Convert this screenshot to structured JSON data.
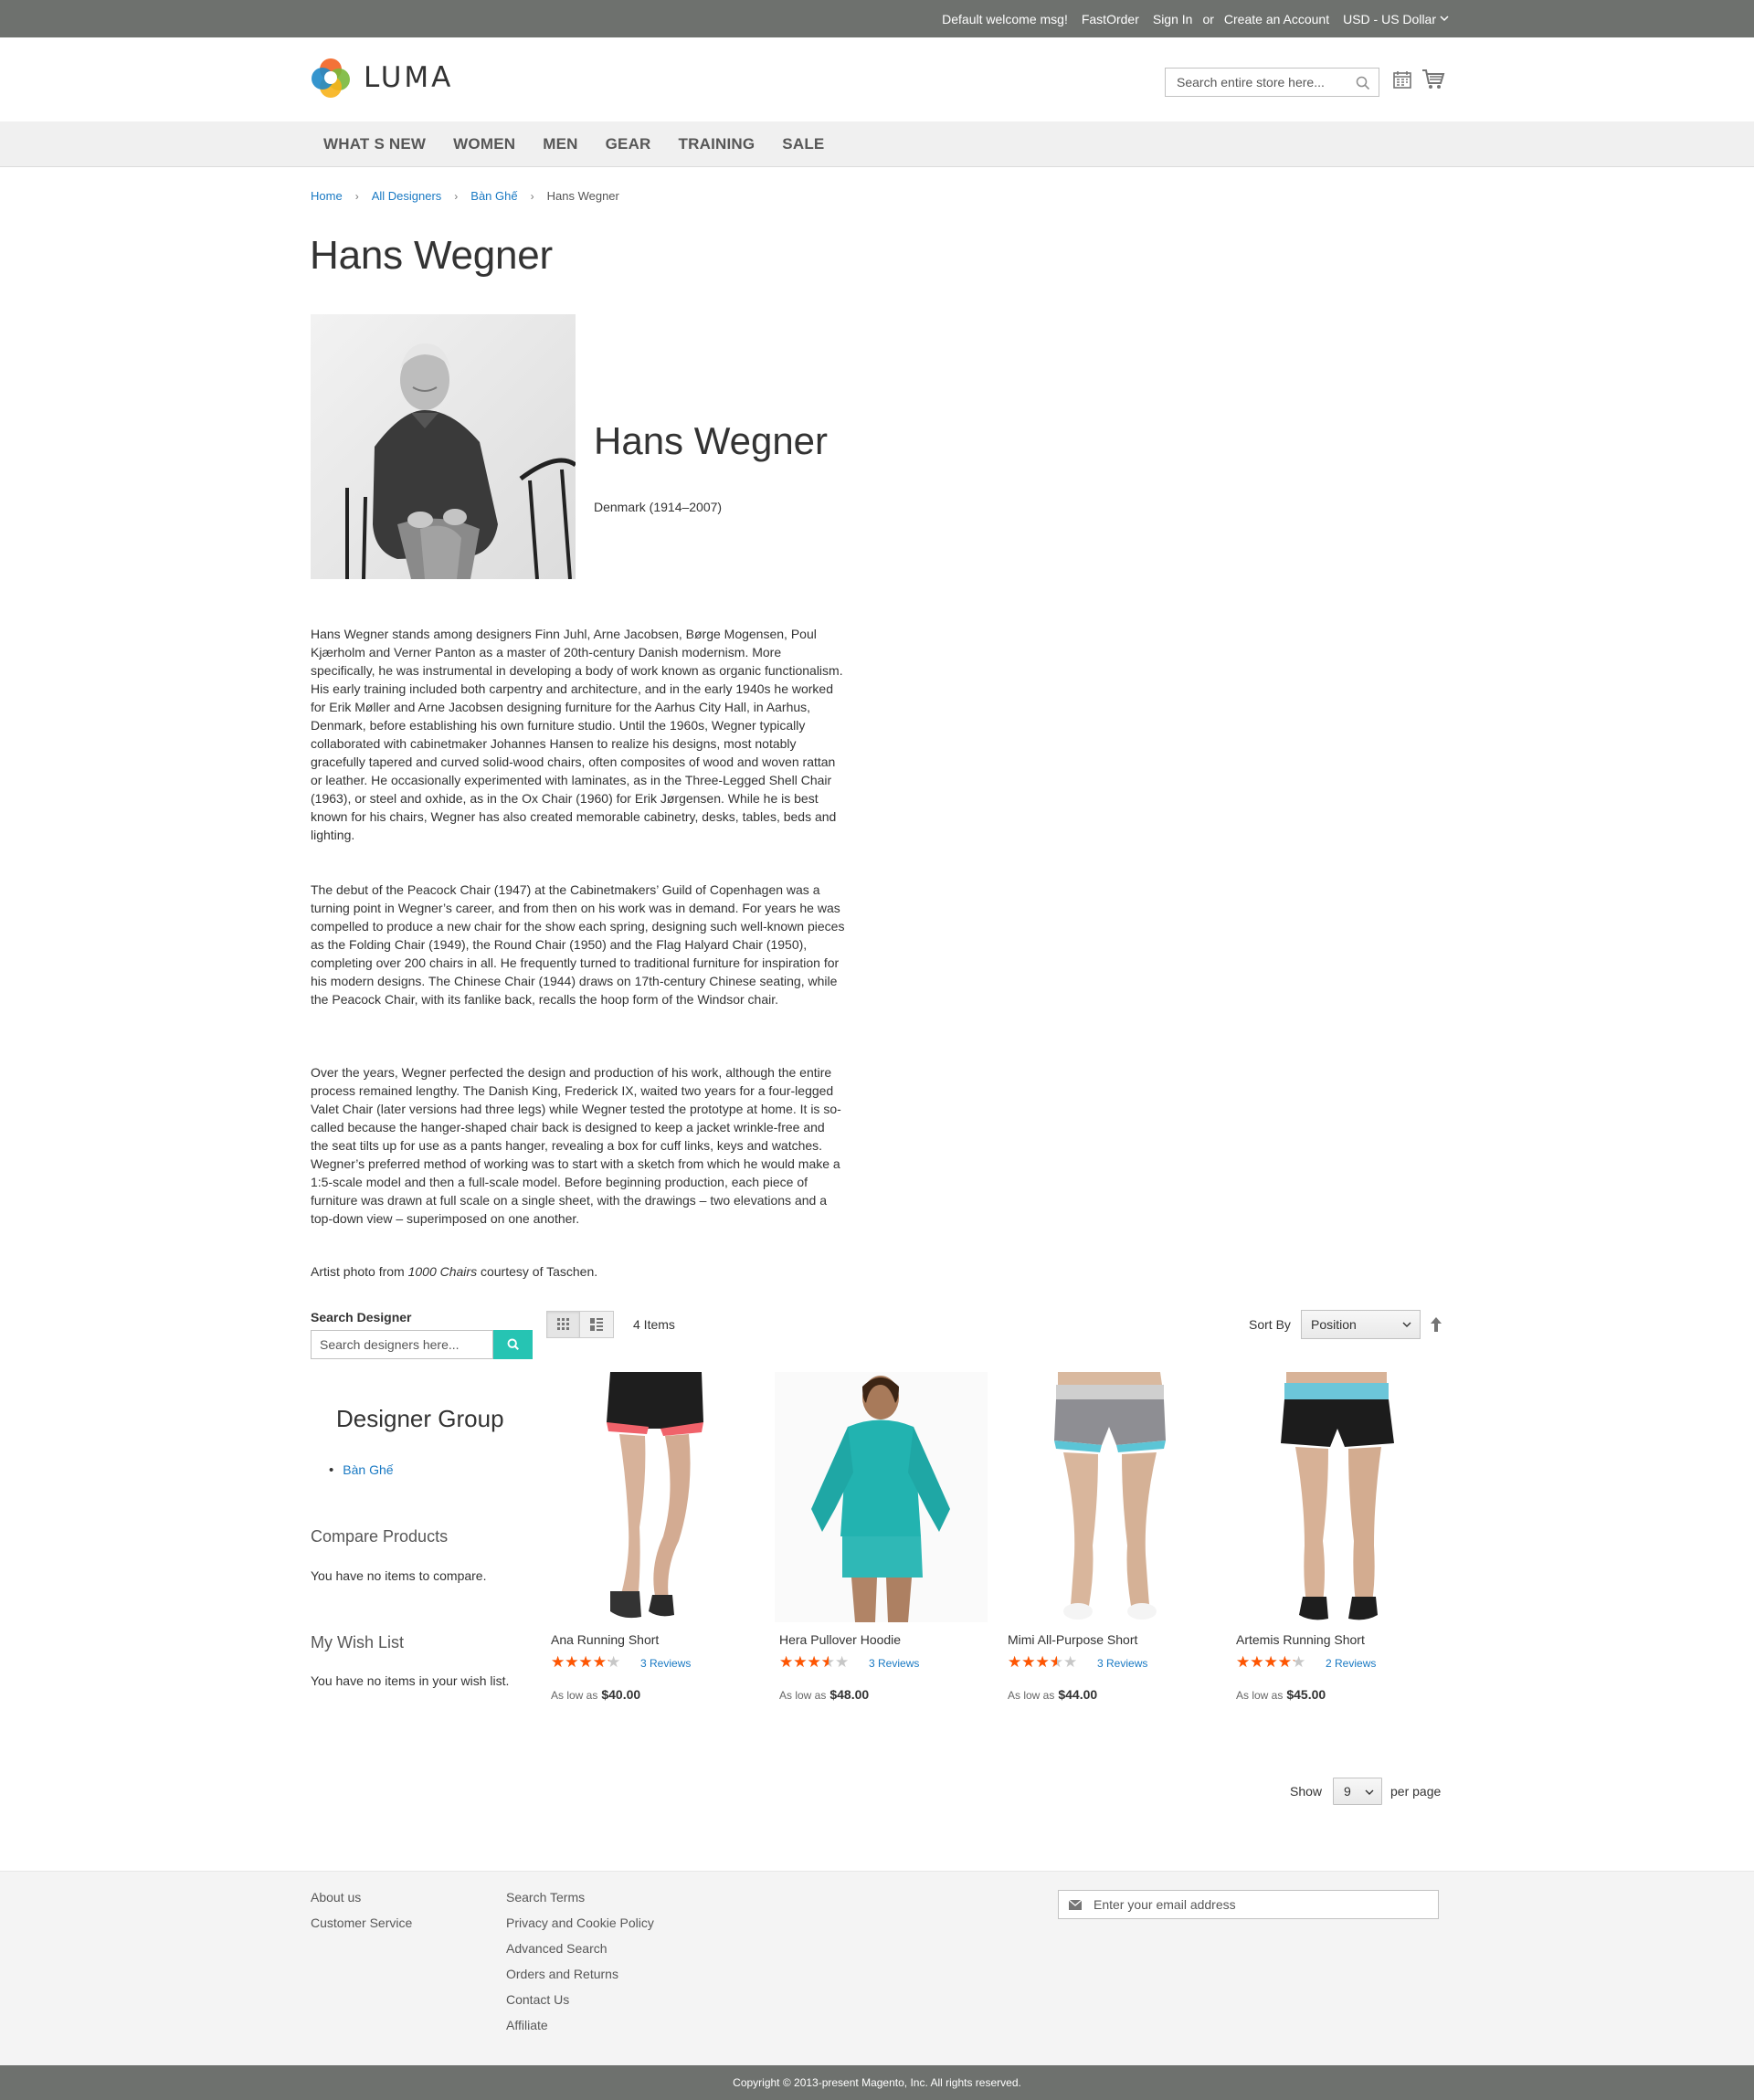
{
  "top_links": {
    "welcome": "Default welcome msg!",
    "fast_order": "FastOrder",
    "sign_in": "Sign In",
    "or": "or",
    "create_account": "Create an Account",
    "currency": "USD - US Dollar"
  },
  "header": {
    "logo_text": "LUMA",
    "search_placeholder": "Search entire store here..."
  },
  "nav": {
    "items": [
      "WHAT S NEW",
      "WOMEN",
      "MEN",
      "GEAR",
      "TRAINING",
      "SALE"
    ]
  },
  "breadcrumb": {
    "items": [
      "Home",
      "All Designers",
      "Bàn Ghế"
    ],
    "current": "Hans Wegner"
  },
  "page_title": "Hans Wegner",
  "designer": {
    "name": "Hans Wegner",
    "country": "Denmark (1914–2007)",
    "bio": [
      "Hans Wegner stands among designers Finn Juhl, Arne Jacobsen, Børge Mogensen, Poul Kjærholm and Verner Panton as a master of 20th-century Danish modernism. More specifically, he was instrumental in developing a body of work known as organic functionalism. His early training included both carpentry and architecture, and in the early 1940s he worked for Erik Møller and Arne Jacobsen designing furniture for the Aarhus City Hall, in Aarhus, Denmark, before establishing his own furniture studio. Until the 1960s, Wegner typically collaborated with cabinetmaker Johannes Hansen to realize his designs, most notably gracefully tapered and curved solid-wood chairs, often composites of wood and woven rattan or leather. He occasionally experimented with laminates, as in the Three-Legged Shell Chair (1963), or steel and oxhide, as in the Ox Chair (1960) for Erik Jørgensen. While he is best known for his chairs, Wegner has also created memorable cabinetry, desks, tables, beds and lighting.",
      "The debut of the Peacock Chair (1947) at the Cabinetmakers’ Guild of Copenhagen was a turning point in Wegner’s career, and from then on his work was in demand. For years he was compelled to produce a new chair for the show each spring, designing such well-known pieces as the Folding Chair (1949), the Round Chair (1950) and the Flag Halyard Chair (1950), completing over 200 chairs in all. He frequently turned to traditional furniture for inspiration for his modern designs. The Chinese Chair (1944) draws on 17th-century Chinese seating, while the Peacock Chair, with its fanlike back, recalls the hoop form of the Windsor chair.",
      "Over the years, Wegner perfected the design and production of his work, although the entire process remained lengthy. The Danish King, Frederick IX, waited two years for a four-legged Valet Chair (later versions had three legs) while Wegner tested the prototype at home. It is so-called because the hanger-shaped chair back is designed to keep a jacket wrinkle-free and the seat tilts up for use as a pants hanger, revealing a box for cuff links, keys and watches. Wegner’s preferred method of working was to start with a sketch from which he would make a 1:5-scale model and then a full-scale model. Before beginning production, each piece of furniture was drawn at full scale on a single sheet, with the drawings – two elevations and a top-down view – superimposed on one another."
    ],
    "credit_prefix": "Artist photo from ",
    "credit_book": "1000 Chairs",
    "credit_suffix": " courtesy of Taschen."
  },
  "sidebar": {
    "search_label": "Search Designer",
    "search_placeholder": "Search designers here...",
    "group_title": "Designer Group",
    "group_items": [
      "Bàn Ghế"
    ],
    "compare_title": "Compare Products",
    "compare_empty": "You have no items to compare.",
    "wishlist_title": "My Wish List",
    "wishlist_empty": "You have no items in your wish list."
  },
  "toolbar": {
    "item_count": "4 Items",
    "sort_label": "Sort By",
    "sort_value": "Position",
    "show_label": "Show",
    "limit_value": "9",
    "per_page": "per page"
  },
  "products": [
    {
      "name": "Ana Running Short",
      "rating_pct": 80,
      "reviews": "3 Reviews",
      "price_prefix": "As low as",
      "price": "$40.00"
    },
    {
      "name": "Hera Pullover Hoodie",
      "rating_pct": 67,
      "reviews": "3 Reviews",
      "price_prefix": "As low as",
      "price": "$48.00"
    },
    {
      "name": "Mimi All-Purpose Short",
      "rating_pct": 67,
      "reviews": "3 Reviews",
      "price_prefix": "As low as",
      "price": "$44.00"
    },
    {
      "name": "Artemis Running Short",
      "rating_pct": 80,
      "reviews": "2 Reviews",
      "price_prefix": "As low as",
      "price": "$45.00"
    }
  ],
  "footer": {
    "col1": [
      "About us",
      "Customer Service"
    ],
    "col2": [
      "Search Terms",
      "Privacy and Cookie Policy",
      "Advanced Search",
      "Orders and Returns",
      "Contact Us",
      "Affiliate"
    ],
    "newsletter_placeholder": "Enter your email address",
    "copyright": "Copyright © 2013-present Magento, Inc. All rights reserved."
  },
  "colors": {
    "top_bar": "#6e716e",
    "link": "#1979c3",
    "search_button": "#26c4b3",
    "star": "#ff5501"
  }
}
